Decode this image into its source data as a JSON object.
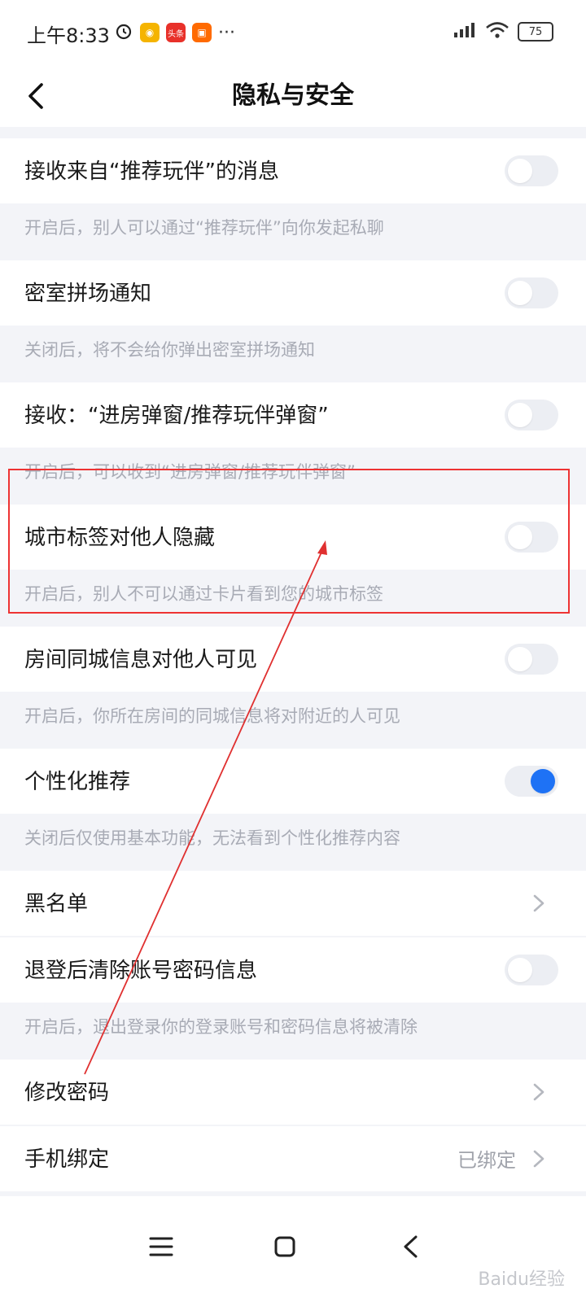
{
  "status_bar": {
    "time": "上午8:33",
    "app_labels": [
      "头条"
    ],
    "battery": "75",
    "more": "···"
  },
  "header": {
    "title": "隐私与安全",
    "back_icon": "chevron-left-icon"
  },
  "settings": [
    {
      "label": "接收来自“推荐玩伴”的消息",
      "type": "toggle",
      "on": false,
      "desc": "开启后，别人可以通过“推荐玩伴”向你发起私聊"
    },
    {
      "label": "密室拼场通知",
      "type": "toggle",
      "on": false,
      "desc": "关闭后，将不会给你弹出密室拼场通知"
    },
    {
      "label": "接收：“进房弹窗/推荐玩伴弹窗”",
      "type": "toggle",
      "on": false,
      "desc": "开启后，可以收到“进房弹窗/推荐玩伴弹窗”"
    },
    {
      "label": "城市标签对他人隐藏",
      "type": "toggle",
      "on": false,
      "desc": "开启后，别人不可以通过卡片看到您的城市标签"
    },
    {
      "label": "房间同城信息对他人可见",
      "type": "toggle",
      "on": false,
      "desc": "开启后，你所在房间的同城信息将对附近的人可见"
    },
    {
      "label": "个性化推荐",
      "type": "toggle",
      "on": true,
      "desc": "关闭后仅使用基本功能，无法看到个性化推荐内容"
    },
    {
      "label": "黑名单",
      "type": "link"
    },
    {
      "label": "退登后清除账号密码信息",
      "type": "toggle",
      "on": false,
      "desc": "开启后，退出登录你的登录账号和密码信息将被清除"
    },
    {
      "label": "修改密码",
      "type": "link"
    },
    {
      "label": "手机绑定",
      "type": "link",
      "value": "已绑定"
    }
  ],
  "colors": {
    "accent": "#1e72f5",
    "highlight": "#e33333",
    "bg": "#f3f4f8"
  },
  "watermark": "Baidu经验"
}
